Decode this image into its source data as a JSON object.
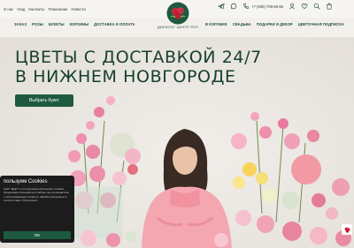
{
  "topbar": {
    "links": [
      "О нас",
      "Уход",
      "Контакты",
      "Пожелание",
      "Новости"
    ],
    "phone": "+7 (930) 706-55-55",
    "icons": [
      "telegram-icon",
      "whatsapp-icon",
      "phone-icon",
      "user-icon",
      "heart-icon",
      "search-icon",
      "cart-icon"
    ]
  },
  "logo": {
    "text": "ДИСКОНТ ЦЕНТР РОЗ"
  },
  "nav": {
    "left": [
      "ЗАКАЗ",
      "РОЗЫ",
      "БУКЕТЫ",
      "КОРЗИНЫ",
      "ДОСТАВКА И ОПЛАТА"
    ],
    "right": [
      "В КОРОБКЕ",
      "СВАДЬБА",
      "ПОДАРКИ И ДЕКОР",
      "ЦВЕТОЧНАЯ ПОДПИСКА"
    ]
  },
  "hero": {
    "title_line1": "ЦВЕТЫ С ДОСТАВКОЙ 24/7",
    "title_line2": "В НИЖНЕМ НОВГОРОДЕ",
    "button": "Выбрать букет"
  },
  "cookie": {
    "title": "пользуем Cookies",
    "text": "Сайт \"ДЦР\" и его партнеры используют cookies. Продолжая пользоваться сайтом, вы соглашаетесь с использованием cookies и обработкой данных в соответствии с Политикой.",
    "ok": "OK"
  },
  "colors": {
    "brand_green": "#1e5a3f",
    "text_green": "#17402e",
    "pink": "#e88aa3"
  }
}
